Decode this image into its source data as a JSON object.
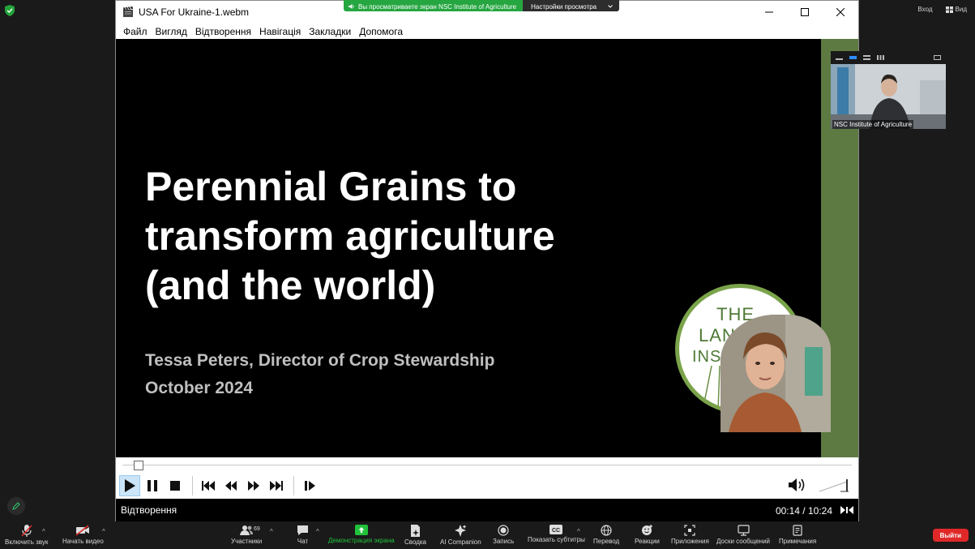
{
  "zoom": {
    "top_right": {
      "signin": "Вход",
      "view": "Вид"
    },
    "share_banner": {
      "message": "Вы просматриваете экран NSC Institute of Agriculture",
      "settings": "Настройки просмотра"
    },
    "participant_name": "NSC Institute of Agriculture",
    "toolbar": {
      "unmute": "Включить звук",
      "start_video": "Начать видео",
      "participants": "Участники",
      "participants_count": "69",
      "chat": "Чат",
      "share": "Демонстрация экрана",
      "summary": "Сводка",
      "ai_companion": "AI Companion",
      "record": "Запись",
      "captions": "Показать субтитры",
      "captions_icon_text": "CC",
      "translate": "Перевод",
      "reactions": "Реакции",
      "apps": "Приложения",
      "whiteboards": "Доски сообщений",
      "notes": "Примечания",
      "leave": "Выйти"
    }
  },
  "vlc": {
    "title": "USA For Ukraine-1.webm",
    "menu": [
      "Файл",
      "Вигляд",
      "Відтворення",
      "Навігація",
      "Закладки",
      "Допомога"
    ],
    "status": "Відтворення",
    "time": "00:14 / 10:24",
    "progress": 0.022
  },
  "slide": {
    "title_lines": [
      "Perennial Grains to",
      "transform agriculture",
      "(and the world)"
    ],
    "presenter": "Tessa Peters, Director of Crop Stewardship",
    "date": "October 2024",
    "logo_lines": [
      "THE",
      "LAND",
      "INSTITUTE"
    ]
  }
}
